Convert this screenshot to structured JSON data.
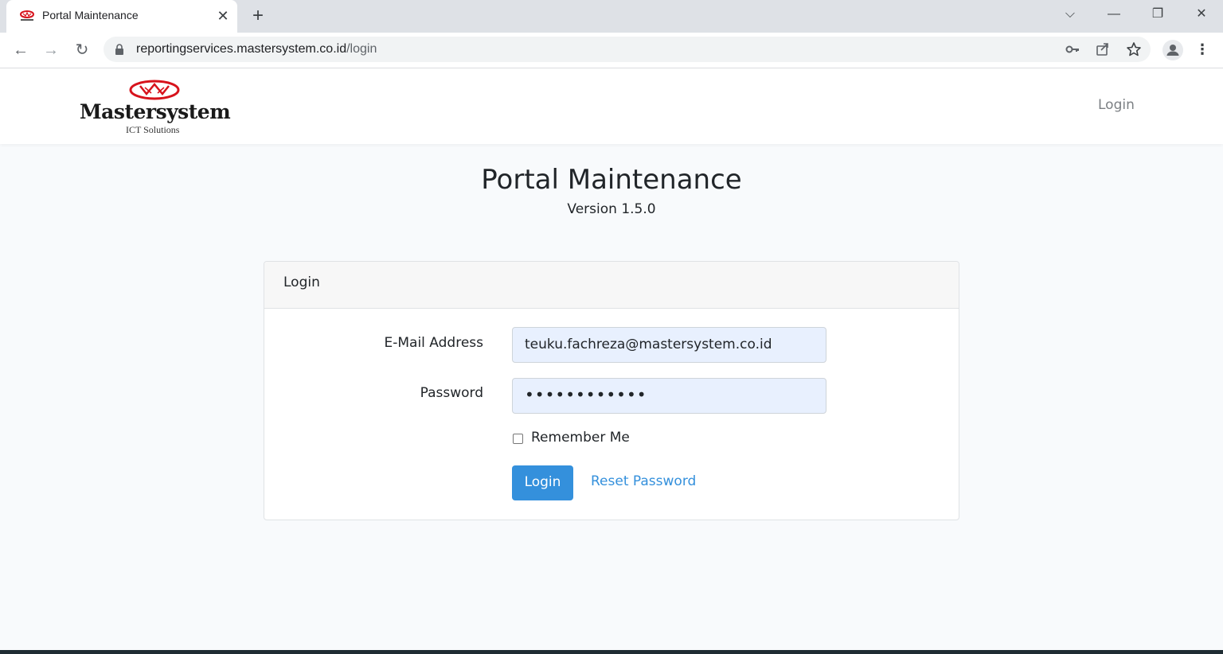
{
  "browser": {
    "tab_title": "Portal Maintenance",
    "tab_close": "✕",
    "new_tab": "+",
    "url_host": "reportingservices.mastersystem.co.id",
    "url_path": "/login",
    "window_controls": {
      "dropdown": "⌵",
      "minimize": "—",
      "restore": "❐",
      "close": "✕"
    },
    "nav": {
      "back": "←",
      "forward": "→",
      "reload": "↻"
    },
    "icons": [
      "key-icon",
      "share-icon",
      "star-icon",
      "profile-icon",
      "menu-icon"
    ]
  },
  "navbar": {
    "logo_text": "Mastersystem",
    "logo_sub": "ICT Solutions",
    "login_link": "Login"
  },
  "page": {
    "title": "Portal Maintenance",
    "version": "Version 1.5.0"
  },
  "login_card": {
    "header": "Login",
    "email_label": "E-Mail Address",
    "email_value": "teuku.fachreza@mastersystem.co.id",
    "password_label": "Password",
    "password_masked": "••••••••••••",
    "remember_label": "Remember Me",
    "remember_checked": false,
    "submit_label": "Login",
    "reset_label": "Reset Password"
  },
  "colors": {
    "primary": "#3490dc",
    "autofill_bg": "#e8f0fe",
    "page_bg": "#f8fafc",
    "brand_red": "#d7131c"
  }
}
